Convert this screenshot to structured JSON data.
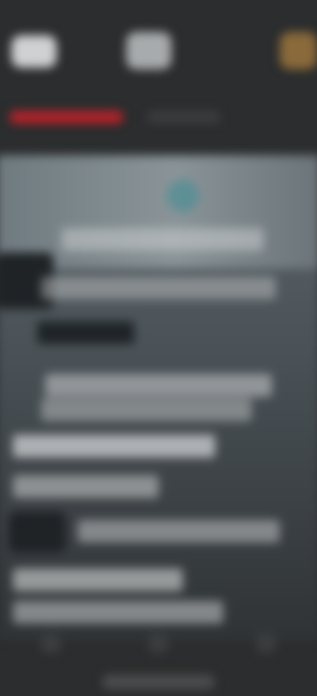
{
  "status_bar": {
    "time": "",
    "signal": ""
  },
  "tabs": [
    {
      "label": ""
    },
    {
      "label": ""
    }
  ],
  "content": {
    "headline": "",
    "body": ""
  },
  "colors": {
    "accent": "#b3232a",
    "background": "#2b2d2e",
    "panel_top": "#6f7a80",
    "panel_bottom": "#2f3335"
  },
  "icons": [
    "app-icon-1",
    "app-icon-2",
    "app-icon-3"
  ]
}
